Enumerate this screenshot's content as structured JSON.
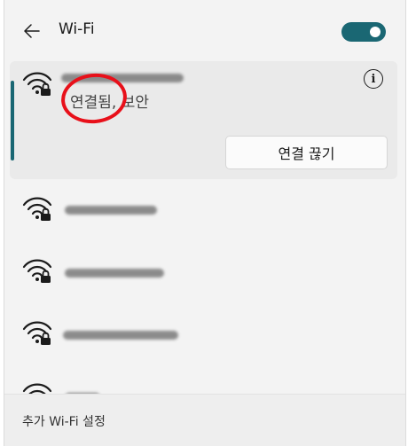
{
  "header": {
    "title": "Wi-Fi",
    "toggle_on": true,
    "accent_color": "#1a6773"
  },
  "active_network": {
    "ssid": "",
    "status": "연결됨, 보안",
    "disconnect_label": "연결 끊기",
    "info_glyph": "i"
  },
  "networks": [
    {
      "ssid": ""
    },
    {
      "ssid": ""
    },
    {
      "ssid": ""
    },
    {
      "ssid": ""
    }
  ],
  "footer": {
    "more_settings_label": "추가 Wi-Fi 설정"
  },
  "annotation": {
    "color": "#e8101a"
  }
}
